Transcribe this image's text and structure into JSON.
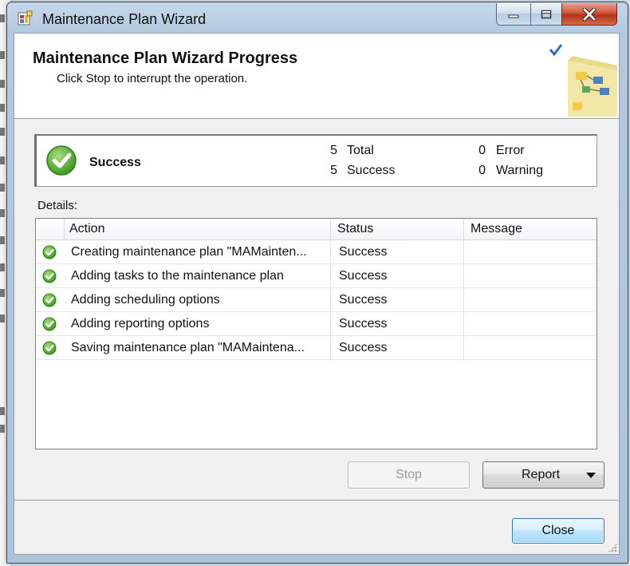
{
  "window": {
    "title": "Maintenance Plan Wizard"
  },
  "header": {
    "title": "Maintenance Plan Wizard Progress",
    "subtitle": "Click Stop to interrupt the operation."
  },
  "summary": {
    "status": "Success",
    "total_count": "5",
    "total_label": "Total",
    "success_count": "5",
    "success_label": "Success",
    "error_count": "0",
    "error_label": "Error",
    "warning_count": "0",
    "warning_label": "Warning"
  },
  "details": {
    "label": "Details:",
    "columns": [
      "Action",
      "Status",
      "Message"
    ],
    "rows": [
      {
        "action": "Creating maintenance plan \"MAMainten...",
        "status": "Success",
        "message": ""
      },
      {
        "action": "Adding tasks to the maintenance plan",
        "status": "Success",
        "message": ""
      },
      {
        "action": "Adding scheduling options",
        "status": "Success",
        "message": ""
      },
      {
        "action": "Adding reporting options",
        "status": "Success",
        "message": ""
      },
      {
        "action": "Saving maintenance plan \"MAMaintena...",
        "status": "Success",
        "message": ""
      }
    ]
  },
  "buttons": {
    "stop": "Stop",
    "report": "Report",
    "close": "Close"
  },
  "icons": {
    "success": "check-circle-icon",
    "header": "wizard-flowchart-icon"
  },
  "colors": {
    "success_green": "#4caf2a",
    "header_check": "#2f6fc9"
  }
}
